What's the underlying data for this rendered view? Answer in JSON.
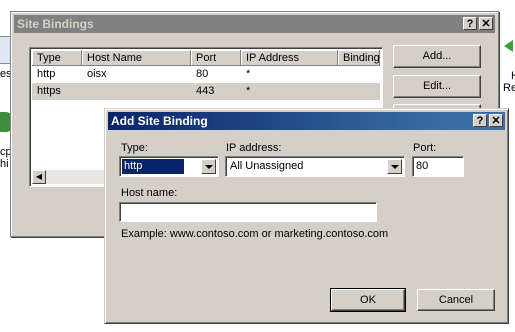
{
  "background": {
    "left_fragments": [
      "es",
      "cpu",
      "hi"
    ],
    "right_fragments": [
      "H",
      "Re"
    ]
  },
  "site_bindings": {
    "title": "Site Bindings",
    "help_btn": "?",
    "close_btn": "✕",
    "columns": [
      "Type",
      "Host Name",
      "Port",
      "IP Address",
      "Binding"
    ],
    "rows": [
      {
        "type": "http",
        "host": "oisx",
        "port": "80",
        "ip": "*",
        "binding": ""
      },
      {
        "type": "https",
        "host": "",
        "port": "443",
        "ip": "*",
        "binding": ""
      }
    ],
    "add_label": "Add...",
    "edit_label": "Edit...",
    "scroll_left": "◀"
  },
  "add_site_binding": {
    "title": "Add Site Binding",
    "help_btn": "?",
    "close_btn": "✕",
    "type_label": "Type:",
    "type_value": "http",
    "ip_label": "IP address:",
    "ip_value": "All Unassigned",
    "port_label": "Port:",
    "port_value": "80",
    "host_label": "Host name:",
    "host_value": "",
    "example": "Example: www.contoso.com or marketing.contoso.com",
    "ok_label": "OK",
    "cancel_label": "Cancel"
  },
  "colors": {
    "active_title": "#0a246a",
    "inactive_title": "#808080",
    "face": "#d4d0c8",
    "selection": "#0a246a"
  }
}
